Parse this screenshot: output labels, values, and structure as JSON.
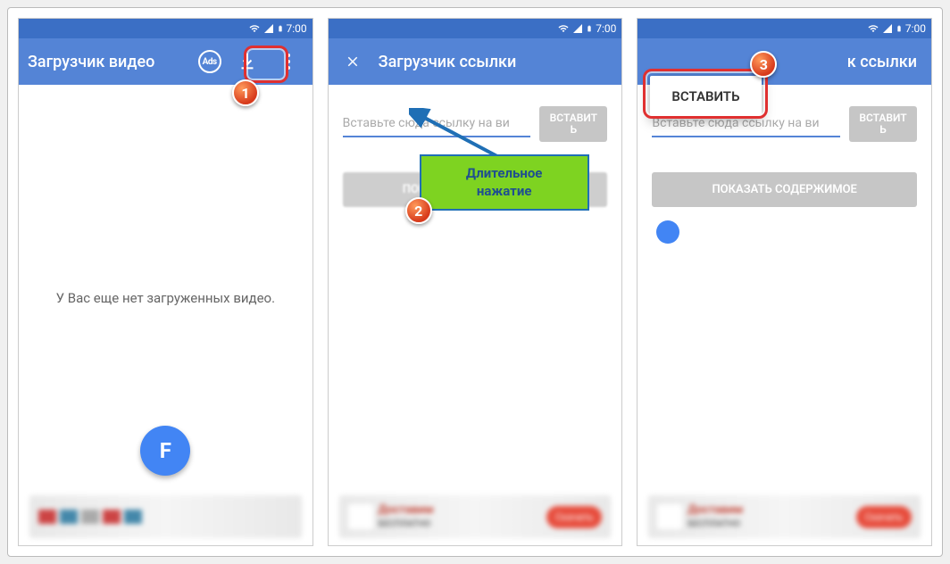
{
  "statusbar": {
    "time": "7:00"
  },
  "screen1": {
    "title": "Загрузчик видео",
    "ads_label": "Ads",
    "empty": "У Вас еще нет загруженных видео.",
    "fab_letter": "F"
  },
  "screen2": {
    "title": "Загрузчик ссылки",
    "placeholder": "Вставьте сюда ссылку на ви",
    "paste_top": "ВСТАВИТ",
    "paste_bottom": "Ь",
    "show": "ПОКАЗАТЬ СОДЕРЖИМОЕ",
    "callout_l1": "Длительное",
    "callout_l2": "нажатие"
  },
  "screen3": {
    "title_suffix": "к ссылки",
    "context_paste": "ВСТАВИТЬ",
    "placeholder": "Вставьте сюда ссылку на ви",
    "paste_top": "ВСТАВИТ",
    "paste_bottom": "Ь",
    "show": "ПОКАЗАТЬ СОДЕРЖИМОЕ"
  },
  "steps": {
    "s1": "1",
    "s2": "2",
    "s3": "3"
  },
  "banner": {
    "text": "Доставим",
    "sub": "БЕСПЛАТНО",
    "btn": "Скачать"
  }
}
